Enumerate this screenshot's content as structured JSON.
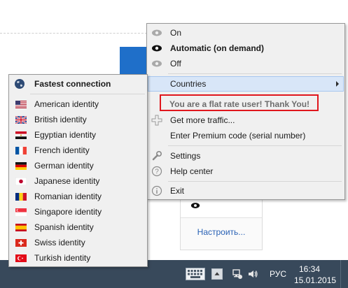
{
  "main_menu": {
    "items": [
      {
        "label": "On",
        "icon": "eye-gray-icon"
      },
      {
        "label": "Automatic (on demand)",
        "icon": "eye-black-icon"
      },
      {
        "label": "Off",
        "icon": "eye-gray-icon"
      },
      {
        "label": "Countries",
        "icon": ""
      },
      {
        "label": "You are a flat rate user! Thank You!",
        "icon": ""
      },
      {
        "label": "Get more traffic...",
        "icon": "plus-icon"
      },
      {
        "label": "Enter Premium code (serial number)",
        "icon": ""
      },
      {
        "label": "Settings",
        "icon": "wrench-icon"
      },
      {
        "label": "Help center",
        "icon": "question-icon"
      },
      {
        "label": "Exit",
        "icon": "info-icon"
      }
    ]
  },
  "countries_menu": {
    "header": "Fastest connection",
    "items": [
      {
        "label": "American identity",
        "flag": "us"
      },
      {
        "label": "British identity",
        "flag": "gb"
      },
      {
        "label": "Egyptian identity",
        "flag": "eg"
      },
      {
        "label": "French identity",
        "flag": "fr"
      },
      {
        "label": "German identity",
        "flag": "de"
      },
      {
        "label": "Japanese identity",
        "flag": "jp"
      },
      {
        "label": "Romanian identity",
        "flag": "ro"
      },
      {
        "label": "Singapore identity",
        "flag": "sg"
      },
      {
        "label": "Spanish identity",
        "flag": "es"
      },
      {
        "label": "Swiss identity",
        "flag": "ch"
      },
      {
        "label": "Turkish identity",
        "flag": "tr"
      }
    ]
  },
  "background": {
    "card_link": "Настроить..."
  },
  "taskbar": {
    "language": "РУС",
    "time": "16:34",
    "date": "15.01.2015"
  },
  "colors": {
    "highlight_border": "#e0161d",
    "menu_bg": "#f0f0f0",
    "taskbar_bg": "#38495b",
    "selection_bg": "#d8e6f8"
  }
}
